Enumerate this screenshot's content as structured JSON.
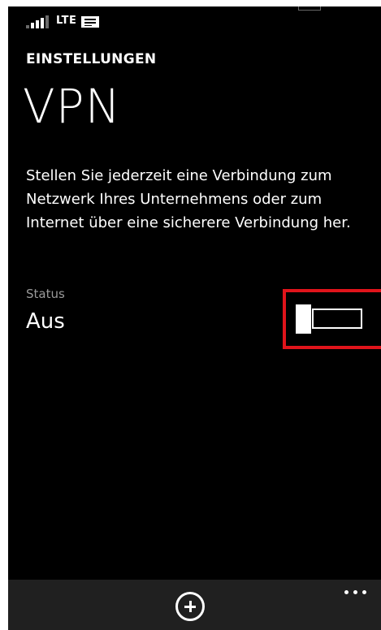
{
  "status_bar": {
    "network": "LTE",
    "icons": [
      "signal-strength-icon",
      "message-icon"
    ]
  },
  "header": {
    "settings_label": "EINSTELLUNGEN",
    "title": "VPN"
  },
  "main": {
    "description": "Stellen Sie jederzeit eine Verbindung zum Netzwerk Ihres Unternehmens oder zum Internet über eine sicherere Verbindung her.",
    "status_label": "Status",
    "status_value": "Aus",
    "toggle_state": "off"
  },
  "colors": {
    "background": "#000000",
    "text": "#ffffff",
    "secondary_text": "#9a9a9a",
    "highlight": "#e0141b",
    "app_bar": "#202020"
  },
  "app_bar": {
    "icons": [
      "add-icon",
      "more-icon"
    ]
  }
}
